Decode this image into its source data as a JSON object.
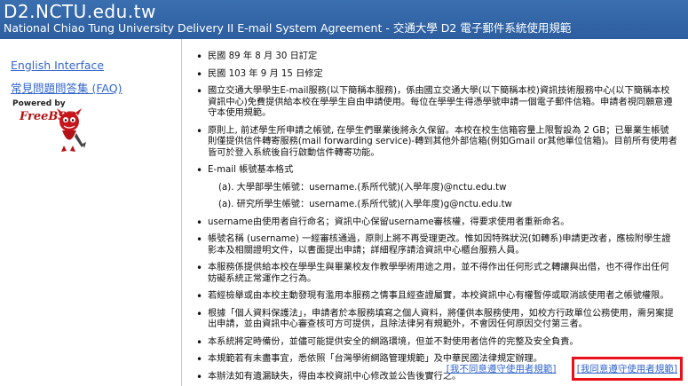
{
  "header": {
    "site": "D2.NCTU.edu.tw",
    "subtitle": "National Chiao Tung University Delivery II E-mail System Agreement - 交通大學 D2 電子郵件系統使用規範"
  },
  "sidebar": {
    "english": "English Interface",
    "faq": "常見問題問答集 (FAQ)",
    "badge_powered": "Powered by",
    "badge_logo": "FreeBSD"
  },
  "terms": [
    "民國 89 年 8 月 30 日訂定",
    "民國 103 年 9 月 15 日修定",
    "國立交通大學學生E-mail服務(以下簡稱本服務)，係由國立交通大學(以下簡稱本校)資訊技術服務中心(以下簡稱本校資訊中心)免費提供給本校在學學生自由申請使用。每位在學學生得憑學號申請一個電子郵件信箱。申請者視同願意遵守本使用規範。",
    "原則上, 前述學生所申請之帳號, 在學生們畢業後將永久保留。本校在校生信箱容量上限暫設為 2 GB；已畢業生帳號則僅提供信件轉寄服務(mail forwarding service)-轉到其他外部信箱(例如Gmail or其他單位信箱)。目前所有使用者皆可於登入系統後自行啟動信件轉寄功能。",
    "E-mail 帳號基本格式"
  ],
  "formats": [
    "(a). 大學部學生帳號：username.(系所代號)(入學年度)@nctu.edu.tw",
    "(a). 研究所學生帳號：username.(系所代號)(入學年度)g@nctu.edu.tw"
  ],
  "terms2": [
    "username由使用者自行命名；資訊中心保留username審核權，得要求使用者重新命名。",
    "帳號名稱 (username) 一經審核通過，原則上將不再受理更改。惟如因特殊狀況(如轉系)申請更改者，應檢附學生證影本及相關證明文件，以書面提出申請；詳細程序請洽資訊中心櫃台服務人員。",
    "本服務係提供給本校在學學生與畢業校友作教學學術用途之用，並不得作出任何形式之轉讓與出借，也不得作出任何妨礙系統正常運作之行為。",
    "若經檢舉或由本校主動發現有濫用本服務之情事且經查證屬實，本校資訊中心有權暫停或取消該使用者之帳號權限。",
    "根據「個人資料保護法」，申請者於本服務填寫之個人資料，將僅供本服務使用，如校方行政單位公務使用，需另案提出申請，並由資訊中心審查核可方可提供，且除法律另有規範外，不會因任何原因交付第三者。",
    "本系統將定時備份，並儘可能提供安全的網路環境，但並不對使用者信件的完整及安全負責。",
    "本規範若有未盡事宜，悉依照「台灣學術網路管理規範」及中華民國法律規定辦理。",
    "本辦法如有遺漏缺失，得由本校資訊中心修改並公告後實行之。"
  ],
  "actions": {
    "disagree": "[我不同意遵守使用者規範]",
    "agree": "[我同意遵守使用者規範]",
    "highlight_color": "#e8111a"
  }
}
